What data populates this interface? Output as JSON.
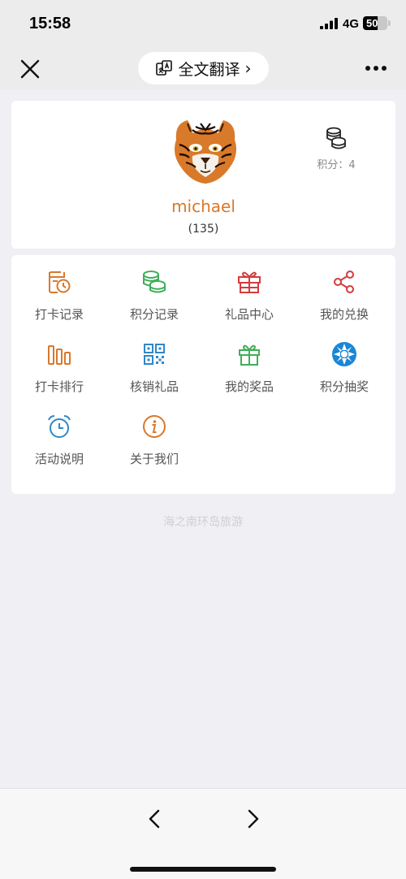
{
  "status_bar": {
    "time": "15:58",
    "network": "4G",
    "battery": "50"
  },
  "nav": {
    "translate_label": "全文翻译",
    "translate_chevron": "›"
  },
  "profile": {
    "username": "michael",
    "count": "(135)",
    "points_label": "积分：4"
  },
  "menu": [
    {
      "label": "打卡记录",
      "icon": "checkin-record-icon",
      "color": "#d9782b"
    },
    {
      "label": "积分记录",
      "icon": "points-record-icon",
      "color": "#3fae5a"
    },
    {
      "label": "礼品中心",
      "icon": "gift-center-icon",
      "color": "#d43b3b"
    },
    {
      "label": "我的兑换",
      "icon": "share-icon",
      "color": "#d43b3b"
    },
    {
      "label": "打卡排行",
      "icon": "ranking-icon",
      "color": "#d9782b"
    },
    {
      "label": "核销礼品",
      "icon": "qrcode-icon",
      "color": "#2f87c9"
    },
    {
      "label": "我的奖品",
      "icon": "prize-icon",
      "color": "#3fae5a"
    },
    {
      "label": "积分抽奖",
      "icon": "lottery-wheel-icon",
      "color": "#1a86d6"
    },
    {
      "label": "活动说明",
      "icon": "alarm-clock-icon",
      "color": "#2f87c9"
    },
    {
      "label": "关于我们",
      "icon": "info-icon",
      "color": "#d9782b"
    }
  ],
  "footer": {
    "text": "海之南环岛旅游"
  }
}
